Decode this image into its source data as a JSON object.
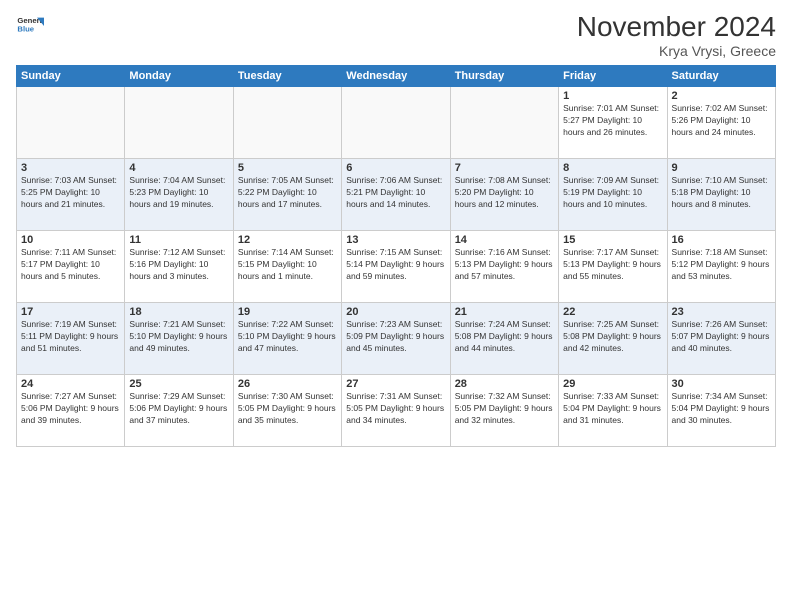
{
  "header": {
    "logo_line1": "General",
    "logo_line2": "Blue",
    "month": "November 2024",
    "location": "Krya Vrysi, Greece"
  },
  "weekdays": [
    "Sunday",
    "Monday",
    "Tuesday",
    "Wednesday",
    "Thursday",
    "Friday",
    "Saturday"
  ],
  "weeks": [
    [
      {
        "day": "",
        "info": ""
      },
      {
        "day": "",
        "info": ""
      },
      {
        "day": "",
        "info": ""
      },
      {
        "day": "",
        "info": ""
      },
      {
        "day": "",
        "info": ""
      },
      {
        "day": "1",
        "info": "Sunrise: 7:01 AM\nSunset: 5:27 PM\nDaylight: 10 hours\nand 26 minutes."
      },
      {
        "day": "2",
        "info": "Sunrise: 7:02 AM\nSunset: 5:26 PM\nDaylight: 10 hours\nand 24 minutes."
      }
    ],
    [
      {
        "day": "3",
        "info": "Sunrise: 7:03 AM\nSunset: 5:25 PM\nDaylight: 10 hours\nand 21 minutes."
      },
      {
        "day": "4",
        "info": "Sunrise: 7:04 AM\nSunset: 5:23 PM\nDaylight: 10 hours\nand 19 minutes."
      },
      {
        "day": "5",
        "info": "Sunrise: 7:05 AM\nSunset: 5:22 PM\nDaylight: 10 hours\nand 17 minutes."
      },
      {
        "day": "6",
        "info": "Sunrise: 7:06 AM\nSunset: 5:21 PM\nDaylight: 10 hours\nand 14 minutes."
      },
      {
        "day": "7",
        "info": "Sunrise: 7:08 AM\nSunset: 5:20 PM\nDaylight: 10 hours\nand 12 minutes."
      },
      {
        "day": "8",
        "info": "Sunrise: 7:09 AM\nSunset: 5:19 PM\nDaylight: 10 hours\nand 10 minutes."
      },
      {
        "day": "9",
        "info": "Sunrise: 7:10 AM\nSunset: 5:18 PM\nDaylight: 10 hours\nand 8 minutes."
      }
    ],
    [
      {
        "day": "10",
        "info": "Sunrise: 7:11 AM\nSunset: 5:17 PM\nDaylight: 10 hours\nand 5 minutes."
      },
      {
        "day": "11",
        "info": "Sunrise: 7:12 AM\nSunset: 5:16 PM\nDaylight: 10 hours\nand 3 minutes."
      },
      {
        "day": "12",
        "info": "Sunrise: 7:14 AM\nSunset: 5:15 PM\nDaylight: 10 hours\nand 1 minute."
      },
      {
        "day": "13",
        "info": "Sunrise: 7:15 AM\nSunset: 5:14 PM\nDaylight: 9 hours\nand 59 minutes."
      },
      {
        "day": "14",
        "info": "Sunrise: 7:16 AM\nSunset: 5:13 PM\nDaylight: 9 hours\nand 57 minutes."
      },
      {
        "day": "15",
        "info": "Sunrise: 7:17 AM\nSunset: 5:13 PM\nDaylight: 9 hours\nand 55 minutes."
      },
      {
        "day": "16",
        "info": "Sunrise: 7:18 AM\nSunset: 5:12 PM\nDaylight: 9 hours\nand 53 minutes."
      }
    ],
    [
      {
        "day": "17",
        "info": "Sunrise: 7:19 AM\nSunset: 5:11 PM\nDaylight: 9 hours\nand 51 minutes."
      },
      {
        "day": "18",
        "info": "Sunrise: 7:21 AM\nSunset: 5:10 PM\nDaylight: 9 hours\nand 49 minutes."
      },
      {
        "day": "19",
        "info": "Sunrise: 7:22 AM\nSunset: 5:10 PM\nDaylight: 9 hours\nand 47 minutes."
      },
      {
        "day": "20",
        "info": "Sunrise: 7:23 AM\nSunset: 5:09 PM\nDaylight: 9 hours\nand 45 minutes."
      },
      {
        "day": "21",
        "info": "Sunrise: 7:24 AM\nSunset: 5:08 PM\nDaylight: 9 hours\nand 44 minutes."
      },
      {
        "day": "22",
        "info": "Sunrise: 7:25 AM\nSunset: 5:08 PM\nDaylight: 9 hours\nand 42 minutes."
      },
      {
        "day": "23",
        "info": "Sunrise: 7:26 AM\nSunset: 5:07 PM\nDaylight: 9 hours\nand 40 minutes."
      }
    ],
    [
      {
        "day": "24",
        "info": "Sunrise: 7:27 AM\nSunset: 5:06 PM\nDaylight: 9 hours\nand 39 minutes."
      },
      {
        "day": "25",
        "info": "Sunrise: 7:29 AM\nSunset: 5:06 PM\nDaylight: 9 hours\nand 37 minutes."
      },
      {
        "day": "26",
        "info": "Sunrise: 7:30 AM\nSunset: 5:05 PM\nDaylight: 9 hours\nand 35 minutes."
      },
      {
        "day": "27",
        "info": "Sunrise: 7:31 AM\nSunset: 5:05 PM\nDaylight: 9 hours\nand 34 minutes."
      },
      {
        "day": "28",
        "info": "Sunrise: 7:32 AM\nSunset: 5:05 PM\nDaylight: 9 hours\nand 32 minutes."
      },
      {
        "day": "29",
        "info": "Sunrise: 7:33 AM\nSunset: 5:04 PM\nDaylight: 9 hours\nand 31 minutes."
      },
      {
        "day": "30",
        "info": "Sunrise: 7:34 AM\nSunset: 5:04 PM\nDaylight: 9 hours\nand 30 minutes."
      }
    ]
  ]
}
